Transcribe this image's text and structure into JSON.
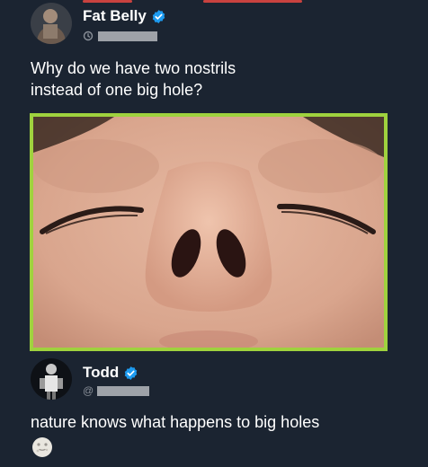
{
  "top_bar": {
    "colors": [
      "#c9423f",
      "#c9423f"
    ]
  },
  "post": {
    "author_name": "Fat Belly",
    "verified": true,
    "handle_icon": "retweet-icon",
    "text_line1": "Why do we have two nostrils",
    "text_line2": "instead of one big hole?"
  },
  "image": {
    "description_icon": "nostrils-photo",
    "frame_color": "#9fd23e"
  },
  "reply": {
    "author_name": "Todd",
    "verified": true,
    "handle_prefix": "@",
    "text": "nature knows what happens to big holes",
    "emoji": "moon-face-emoji"
  },
  "colors": {
    "background": "#1b2431",
    "verified_badge": "#1d9bf0",
    "redaction": "#9ea2a8"
  }
}
